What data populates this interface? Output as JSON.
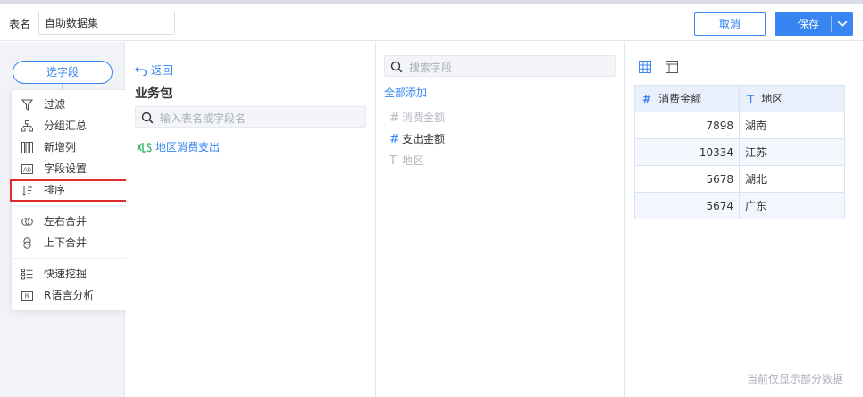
{
  "header": {
    "name_label": "表名",
    "name_value": "自助数据集",
    "cancel_label": "取消",
    "save_label": "保存"
  },
  "left": {
    "select_field_label": "选字段",
    "add_label": "+",
    "menu": [
      {
        "label": "过滤",
        "icon": "filter-icon"
      },
      {
        "label": "分组汇总",
        "icon": "group-summary-icon"
      },
      {
        "label": "新增列",
        "icon": "add-column-icon"
      },
      {
        "label": "字段设置",
        "icon": "field-settings-icon"
      },
      {
        "label": "排序",
        "icon": "sort-icon"
      },
      {
        "label": "左右合并",
        "icon": "join-horizontal-icon"
      },
      {
        "label": "上下合并",
        "icon": "join-vertical-icon"
      },
      {
        "label": "快速挖掘",
        "icon": "quick-mining-icon"
      },
      {
        "label": "R语言分析",
        "icon": "r-analysis-icon"
      }
    ]
  },
  "middle": {
    "back_label": "返回",
    "package_title": "业务包",
    "search_placeholder": "输入表名或字段名",
    "table_name": "地区消费支出"
  },
  "fields": {
    "search_placeholder": "搜索字段",
    "add_all_label": "全部添加",
    "items": [
      {
        "symbol": "#",
        "label": "消费金额",
        "state": "disabled"
      },
      {
        "symbol": "#",
        "label": "支出金额",
        "state": "active"
      },
      {
        "symbol": "T",
        "label": "地区",
        "state": "disabled"
      }
    ]
  },
  "preview": {
    "columns": [
      {
        "symbol": "#",
        "label": "消费金额"
      },
      {
        "symbol": "T",
        "label": "地区"
      }
    ],
    "rows": [
      [
        "7898",
        "湖南"
      ],
      [
        "10334",
        "江苏"
      ],
      [
        "5678",
        "湖北"
      ],
      [
        "5674",
        "广东"
      ]
    ],
    "footnote": "当前仅显示部分数据"
  },
  "colors": {
    "accent": "#3685f2",
    "highlight": "#e02b2b",
    "table_icon_green": "#39b86b"
  }
}
